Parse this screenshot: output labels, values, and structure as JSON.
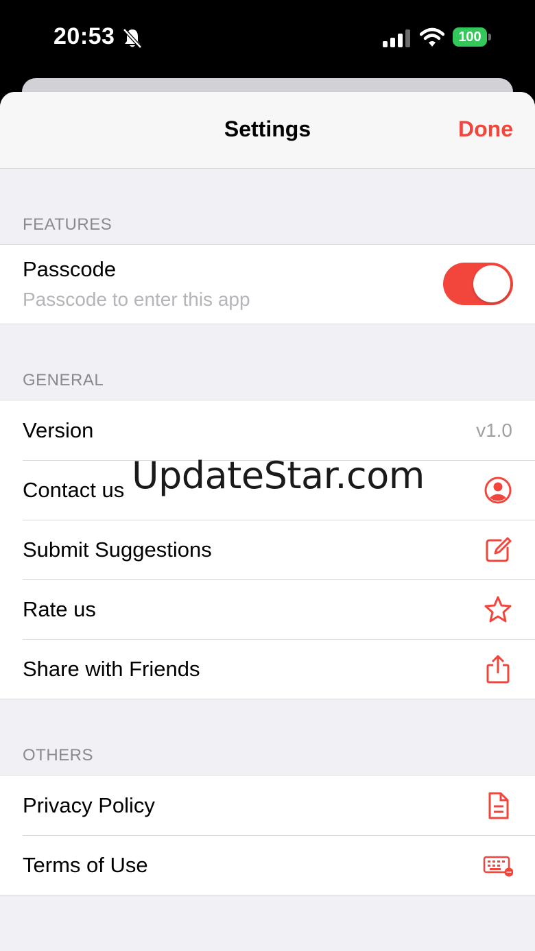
{
  "status_bar": {
    "time": "20:53",
    "battery": "100",
    "icons": [
      "bell-slash-icon",
      "cellular-signal-icon",
      "wifi-icon",
      "battery-icon"
    ]
  },
  "nav": {
    "title": "Settings",
    "done_label": "Done"
  },
  "accent_color": "#f2463d",
  "sections": {
    "features": {
      "header": "FEATURES",
      "passcode": {
        "title": "Passcode",
        "subtitle": "Passcode to enter this app",
        "enabled": true
      }
    },
    "general": {
      "header": "GENERAL",
      "items": [
        {
          "label": "Version",
          "value": "v1.0"
        },
        {
          "label": "Contact us",
          "icon": "person-circle-icon"
        },
        {
          "label": "Submit Suggestions",
          "icon": "square-pencil-icon"
        },
        {
          "label": "Rate us",
          "icon": "star-icon"
        },
        {
          "label": "Share with Friends",
          "icon": "share-icon"
        }
      ]
    },
    "others": {
      "header": "OTHERS",
      "items": [
        {
          "label": "Privacy Policy",
          "icon": "document-icon"
        },
        {
          "label": "Terms of Use",
          "icon": "keyboard-badge-icon"
        }
      ]
    }
  },
  "watermark": "UpdateStar.com"
}
